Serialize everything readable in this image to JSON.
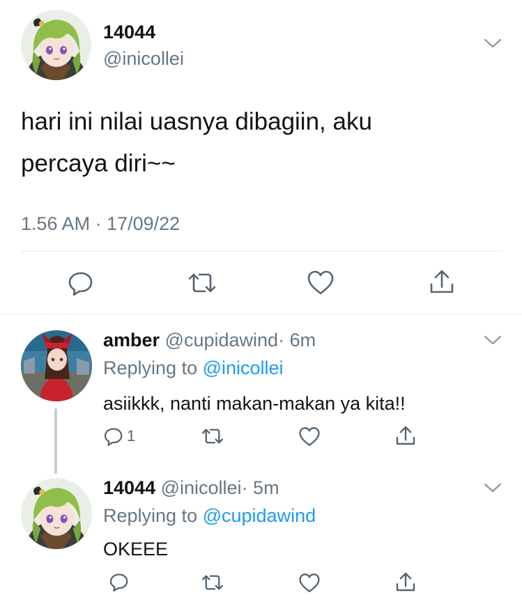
{
  "main_tweet": {
    "display_name": "14044",
    "handle": "@inicollei",
    "text_line1": "hari ini nilai uasnya dibagiin, aku",
    "text_line2": "percaya diri~~",
    "timestamp": "1.56 AM · 17/09/22",
    "avatar_icon": "avatar-collei",
    "actions": [
      "reply-icon",
      "retweet-icon",
      "like-icon",
      "share-icon"
    ]
  },
  "replies": [
    {
      "display_name": "amber",
      "handle": "@cupidawind",
      "time": "· 6m",
      "replying_prefix": "Replying to ",
      "replying_to": "@inicollei",
      "text": "asiikkk, nanti makan-makan ya kita!!",
      "reply_count": "1",
      "avatar_icon": "avatar-amber"
    },
    {
      "display_name": "14044",
      "handle": "@inicollei",
      "time": "· 5m",
      "replying_prefix": "Replying to ",
      "replying_to": "@cupidawind",
      "text": "OKEEE",
      "reply_count": "",
      "avatar_icon": "avatar-collei"
    }
  ],
  "colors": {
    "link": "#1d9bf0",
    "muted": "#657786",
    "divider": "#e6ecf0",
    "icon": "#536471",
    "collei_hair": "#8fbf4a",
    "amber_bg": "#2b6a8f",
    "amber_coat": "#c8232c"
  }
}
